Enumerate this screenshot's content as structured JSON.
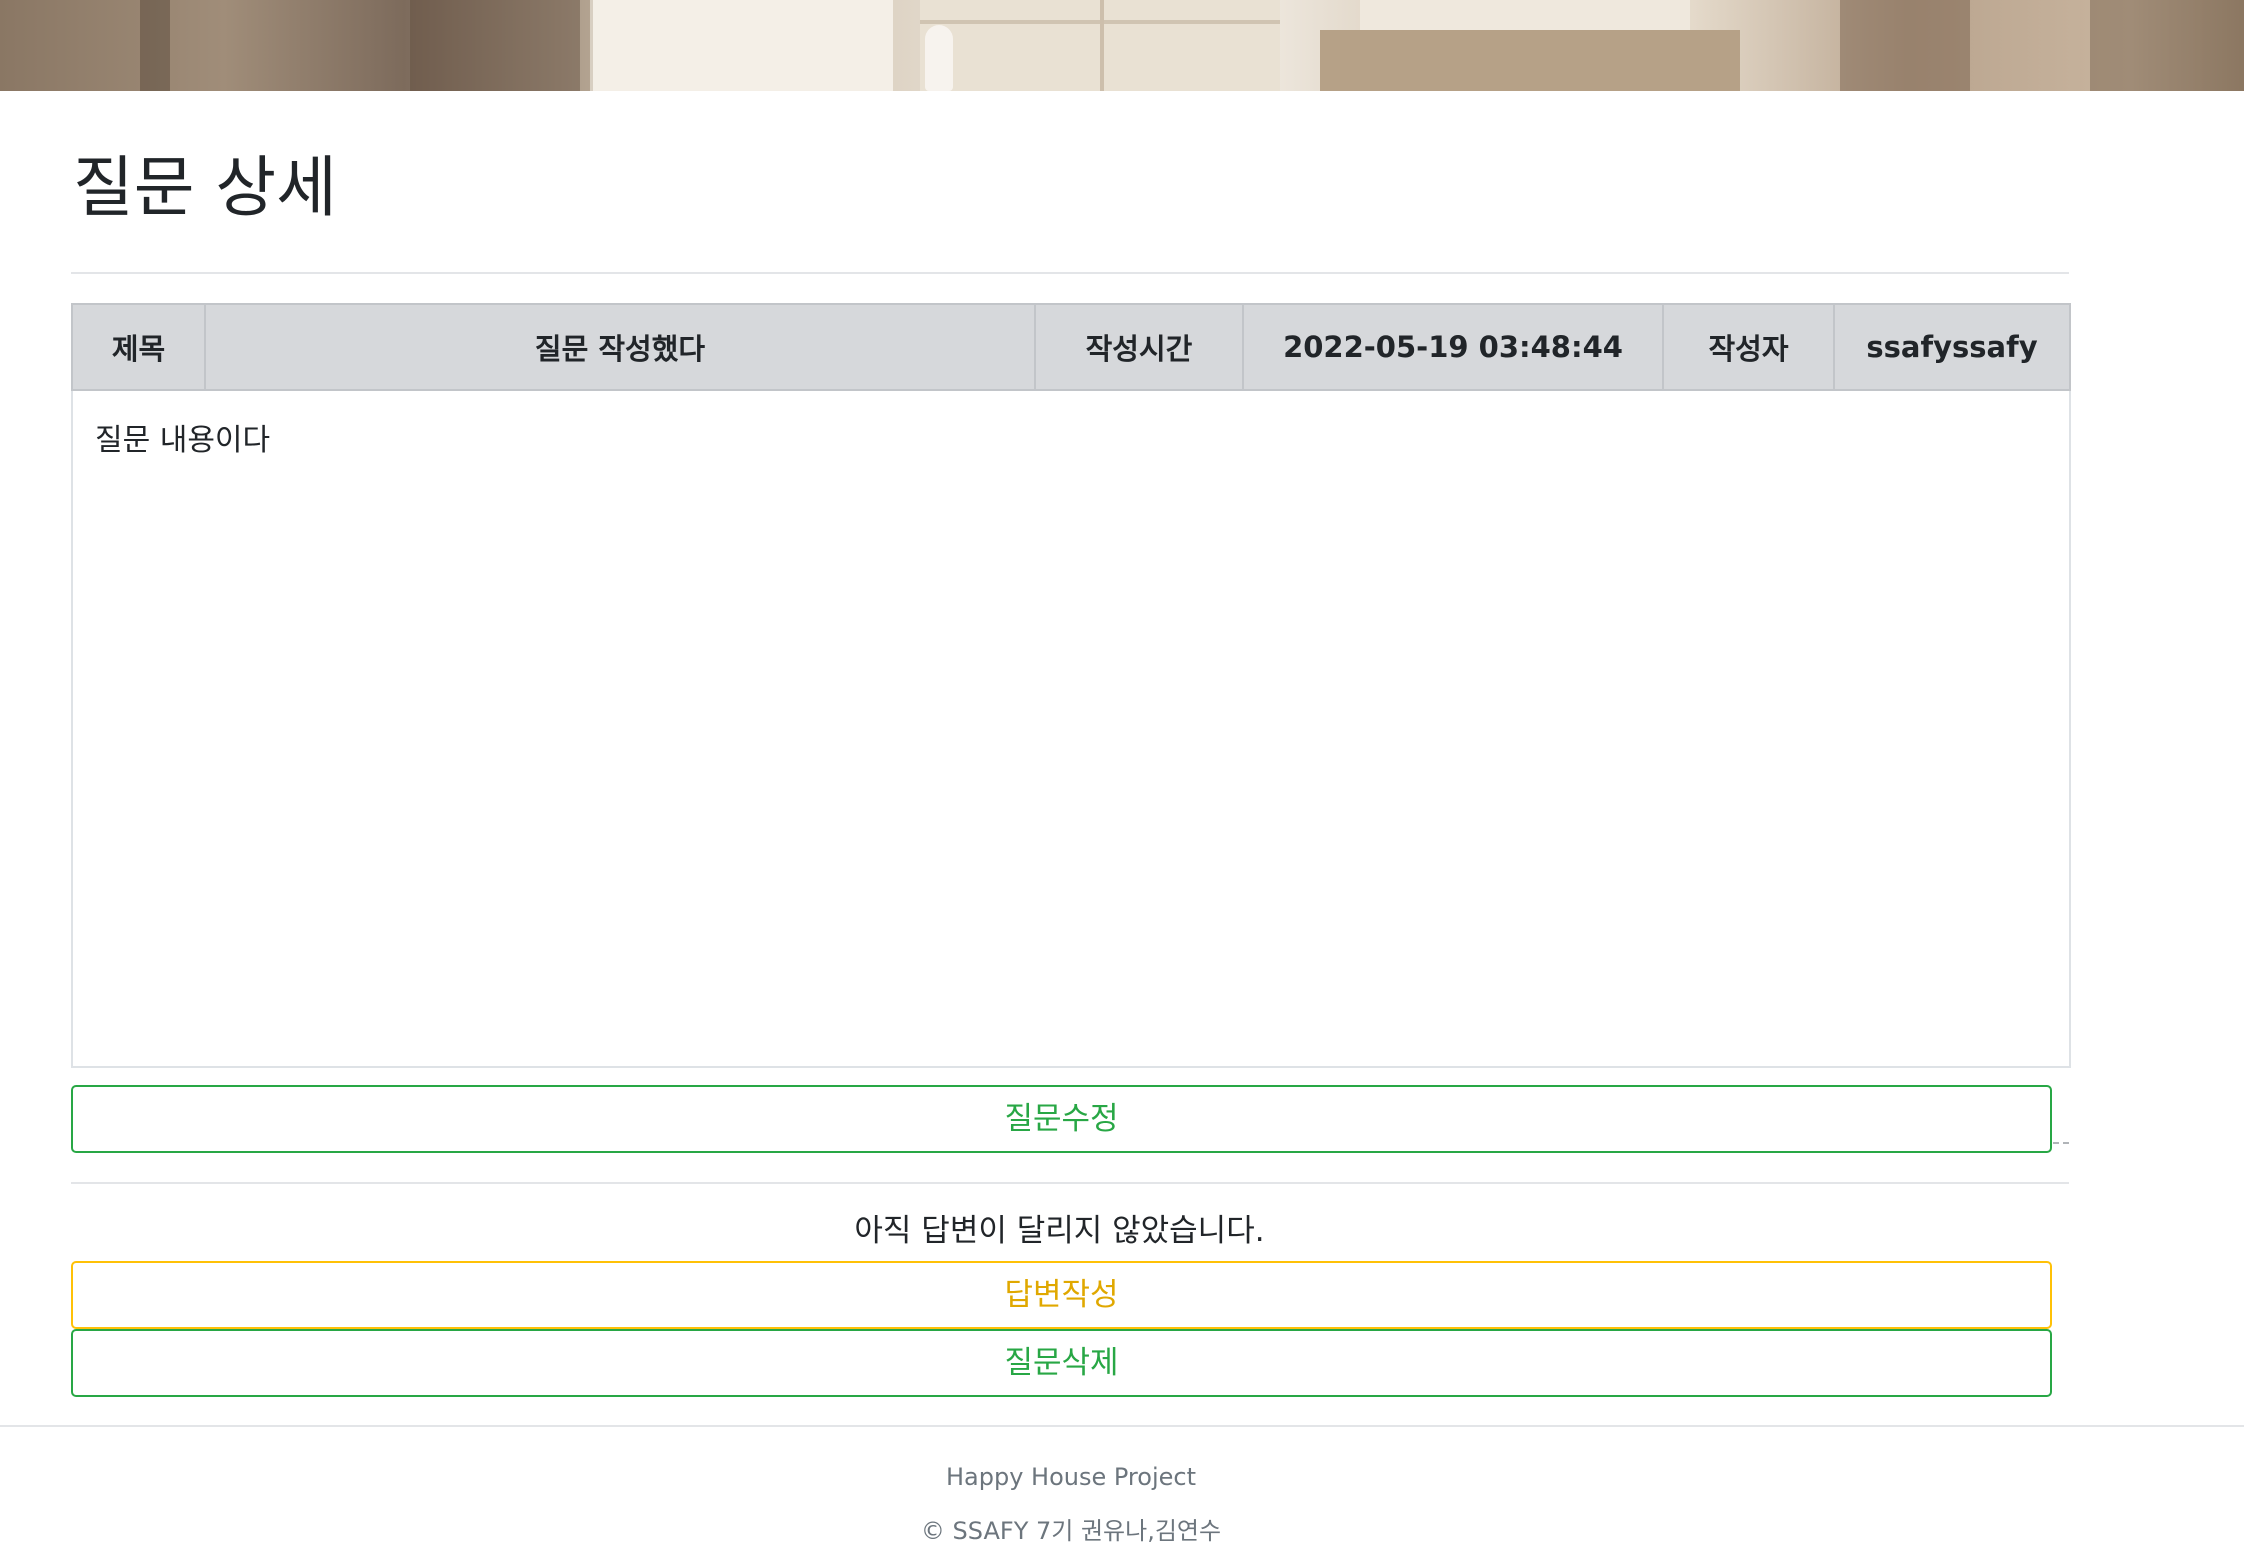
{
  "page": {
    "title": "질문 상세"
  },
  "question": {
    "headers": {
      "title_label": "제목",
      "title_value": "질문 작성했다",
      "time_label": "작성시간",
      "time_value": "2022-05-19 03:48:44",
      "author_label": "작성자",
      "author_value": "ssafyssafy"
    },
    "content": "질문 내용이다"
  },
  "actions": {
    "edit_label": "질문수정",
    "answer_label": "답변작성",
    "delete_label": "질문삭제"
  },
  "answer": {
    "empty_message": "아직 답변이 달리지 않았습니다."
  },
  "footer": {
    "project": "Happy House Project",
    "copyright": "© SSAFY 7기 권유나,김연수"
  },
  "colors": {
    "green": "#28a745",
    "yellow": "#ffc107",
    "header_bg": "#d6d8db"
  }
}
